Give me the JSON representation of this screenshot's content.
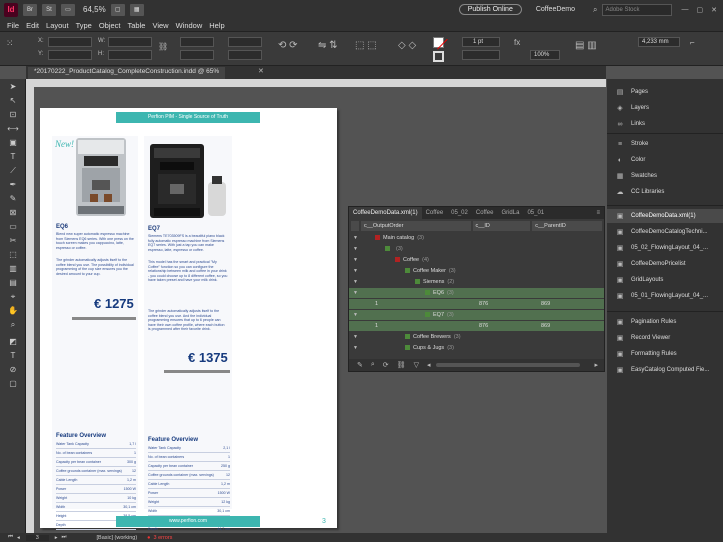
{
  "app": {
    "logo": "Id",
    "zoom": "64,5%",
    "publish_label": "Publish Online",
    "workspace": "CoffeeDemo",
    "stock_search_placeholder": "Adobe Stock"
  },
  "menu": [
    "File",
    "Edit",
    "Layout",
    "Type",
    "Object",
    "Table",
    "View",
    "Window",
    "Help"
  ],
  "control": {
    "stroke_weight": "1 pt",
    "opacity": "100%",
    "dimension": "4,233 mm"
  },
  "document_tab": {
    "label": "*20170222_ProductCatalog_CompleteConstruction.indd @ 65%"
  },
  "page": {
    "header": "Perfion PIM - Single Source of Truth",
    "footer": "www.perfion.com",
    "page_number": "3",
    "products": [
      {
        "badge": "New!",
        "name": "EQ6",
        "desc1": "Blend new super automatic espresso machine from Siemens EQ6 series. With one press on the touch screen makes you cappuccino, latte, espresso or coffee.",
        "desc2": "The grinder automatically adjusts itself to the coffee blend you use. The possibility of individual programming of the cup size ensures you the desired amount to your cup.",
        "price": "€ 1275",
        "features_title": "Feature Overview",
        "features": [
          [
            "Water Tank Capacity",
            "1,7 l"
          ],
          [
            "No. of bean containers",
            "1"
          ],
          [
            "Capacity per bean container",
            "300 g"
          ],
          [
            "Coffee grounds container (max. servings)",
            "12"
          ],
          [
            "Cable Length",
            "1,2 m"
          ],
          [
            "Power",
            "1500 W"
          ],
          [
            "Weight",
            "10 kg"
          ],
          [
            "Width",
            "30,1 cm"
          ],
          [
            "Height",
            "38,5 cm"
          ],
          [
            "Depth",
            "47,8 cm"
          ]
        ]
      },
      {
        "badge": "",
        "name": "EQ7",
        "desc1": "Siemens TE703509FS is a beautiful piano black fully automatic espresso machine from Siemens EQ7 series. With just a tap you can make espresso, latte, espresso or coffee.",
        "desc2": "This model has the smart and practical \"My Coffee\" function so you can configure the relationship between milk and coffee in your drink - you could choose up to 8 different coffee, so you have taken preset and have your milk drink.",
        "desc3": "The grinder automatically adjusts itself to the coffee blend you use. And the individual programming ensures that up to 6 people can have their own coffee profile, where each button is programmed after their favorite drink.",
        "price": "€ 1375",
        "features_title": "Feature Overview",
        "features": [
          [
            "Water Tank Capacity",
            "2,1 l"
          ],
          [
            "No. of bean containers",
            "1"
          ],
          [
            "Capacity per bean container",
            "250 g"
          ],
          [
            "Coffee grounds container (max. servings)",
            "12"
          ],
          [
            "Cable Length",
            "1,2 m"
          ],
          [
            "Power",
            "1500 W"
          ],
          [
            "Weight",
            "12 kg"
          ],
          [
            "Width",
            "30,1 cm"
          ],
          [
            "Height",
            "39,6 cm"
          ],
          [
            "Depth",
            "44,7 cm"
          ]
        ]
      }
    ]
  },
  "panel": {
    "tabs": [
      "CoffeeDemoData.xml(1)",
      "Coffee",
      "05_02",
      "Coffee",
      "GridLa",
      "05_01"
    ],
    "columns": [
      "c__OutputOrder",
      "c__ID",
      "c__ParentID"
    ],
    "rows": [
      {
        "label": "Main catalog",
        "count": "(3)",
        "indent": 0,
        "box": "red",
        "green": false,
        "c1": "",
        "c2": "",
        "c3": ""
      },
      {
        "label": "",
        "count": "(3)",
        "indent": 1,
        "box": "green",
        "green": false,
        "c1": "",
        "c2": "",
        "c3": ""
      },
      {
        "label": "Coffee",
        "count": "(4)",
        "indent": 2,
        "box": "red",
        "green": false,
        "c1": "",
        "c2": "",
        "c3": ""
      },
      {
        "label": "Coffee Maker",
        "count": "(3)",
        "indent": 3,
        "box": "green",
        "green": false,
        "c1": "",
        "c2": "",
        "c3": ""
      },
      {
        "label": "Siemens",
        "count": "(2)",
        "indent": 4,
        "box": "green",
        "green": false,
        "c1": "",
        "c2": "",
        "c3": ""
      },
      {
        "label": "EQ6",
        "count": "(3)",
        "indent": 5,
        "box": "green",
        "green": true,
        "c1": "",
        "c2": "",
        "c3": ""
      },
      {
        "label": "",
        "count": "",
        "indent": 0,
        "box": "",
        "green": true,
        "c1": "1",
        "c2": "876",
        "c3": "869"
      },
      {
        "label": "EQ7",
        "count": "(3)",
        "indent": 5,
        "box": "green",
        "green": true,
        "c1": "",
        "c2": "",
        "c3": ""
      },
      {
        "label": "",
        "count": "",
        "indent": 0,
        "box": "",
        "green": true,
        "c1": "1",
        "c2": "876",
        "c3": "869"
      },
      {
        "label": "Coffee Brewers",
        "count": "(3)",
        "indent": 3,
        "box": "green",
        "green": false,
        "c1": "",
        "c2": "",
        "c3": ""
      },
      {
        "label": "Cups & Jugs",
        "count": "(3)",
        "indent": 3,
        "box": "green",
        "green": false,
        "c1": "",
        "c2": "",
        "c3": ""
      }
    ]
  },
  "dock": {
    "group1": [
      {
        "label": "Pages",
        "icon": "pages-icon",
        "glyph": "▤"
      },
      {
        "label": "Layers",
        "icon": "layers-icon",
        "glyph": "◈"
      },
      {
        "label": "Links",
        "icon": "links-icon",
        "glyph": "∞"
      }
    ],
    "group2": [
      {
        "label": "Stroke",
        "icon": "stroke-icon",
        "glyph": "≡"
      },
      {
        "label": "Color",
        "icon": "color-icon",
        "glyph": "◐"
      },
      {
        "label": "Swatches",
        "icon": "swatches-icon",
        "glyph": "▦"
      },
      {
        "label": "CC Libraries",
        "icon": "cc-libraries-icon",
        "glyph": "☁"
      }
    ],
    "group3": [
      {
        "label": "CoffeeDemoData.xml(1)",
        "icon": "easycatalog-panel-icon",
        "glyph": "▣",
        "selected": true
      },
      {
        "label": "CoffeeDemoCatalogTechni...",
        "icon": "easycatalog-panel-icon",
        "glyph": "▣",
        "selected": false
      },
      {
        "label": "05_02_FlowingLayout_04_...",
        "icon": "easycatalog-panel-icon",
        "glyph": "▣",
        "selected": false
      },
      {
        "label": "CoffeeDemoPricelist",
        "icon": "easycatalog-panel-icon",
        "glyph": "▣",
        "selected": false
      },
      {
        "label": "GridLayouts",
        "icon": "easycatalog-panel-icon",
        "glyph": "▣",
        "selected": false
      },
      {
        "label": "05_01_FlowingLayout_04_...",
        "icon": "easycatalog-panel-icon",
        "glyph": "▣",
        "selected": false
      }
    ],
    "group4": [
      {
        "label": "Pagination Rules",
        "icon": "pagination-rules-icon",
        "glyph": "▣"
      },
      {
        "label": "Record Viewer",
        "icon": "record-viewer-icon",
        "glyph": "▣"
      },
      {
        "label": "Formatting Rules",
        "icon": "formatting-rules-icon",
        "glyph": "▣"
      },
      {
        "label": "EasyCatalog Computed Fie...",
        "icon": "computed-fields-icon",
        "glyph": "▣"
      }
    ]
  },
  "status": {
    "page": "3",
    "style": "[Basic] (working)",
    "errors": "3 errors"
  }
}
